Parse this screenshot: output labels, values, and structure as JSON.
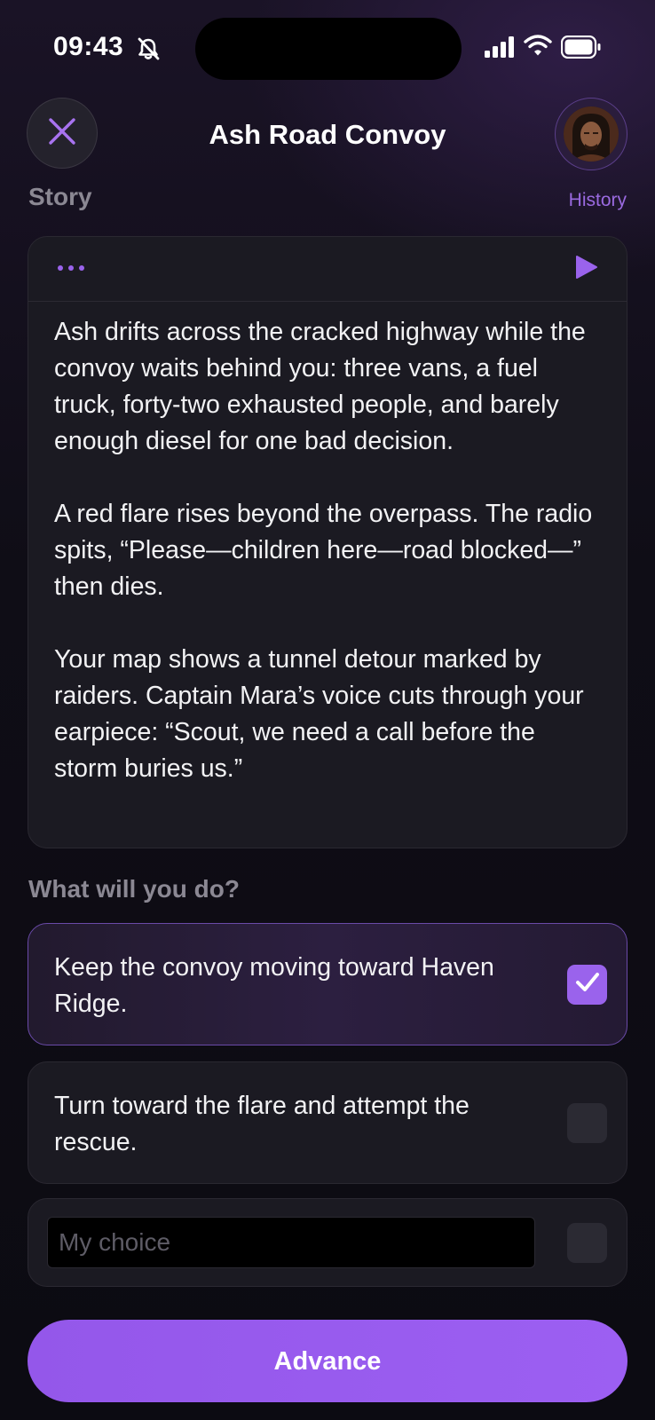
{
  "status_bar": {
    "time": "09:43",
    "icons": [
      "bell-slash-icon",
      "cellular-signal-icon",
      "wifi-icon",
      "battery-icon"
    ]
  },
  "header": {
    "title": "Ash Road Convoy",
    "close_icon": "close-icon",
    "story_label": "Story",
    "history_label": "History"
  },
  "story": {
    "more_icon": "more-dots-icon",
    "play_icon": "play-icon",
    "paragraphs": [
      "Ash drifts across the cracked highway while the convoy waits behind you: three vans, a fuel truck, forty-two exhausted people, and barely enough diesel for one bad decision.",
      "A red flare rises beyond the overpass. The radio spits, “Please—children here—road blocked—” then dies.",
      "Your map shows a tunnel detour marked by raiders. Captain Mara’s voice cuts through your earpiece: “Scout, we need a call before the storm buries us.”"
    ]
  },
  "choices": {
    "question": "What will you do?",
    "options": [
      {
        "label": "Keep the convoy moving toward Haven Ridge.",
        "checked": true
      },
      {
        "label": "Turn toward the flare and attempt the rescue.",
        "checked": false
      }
    ],
    "custom": {
      "value": "",
      "placeholder": "My choice",
      "checked": false
    }
  },
  "actions": {
    "advance_label": "Advance"
  },
  "colors": {
    "accent": "#9a63ec",
    "background": "#0f0d16",
    "card": "#1b1a22",
    "muted_text": "#8b8893",
    "history_link": "#9a6ae0"
  }
}
